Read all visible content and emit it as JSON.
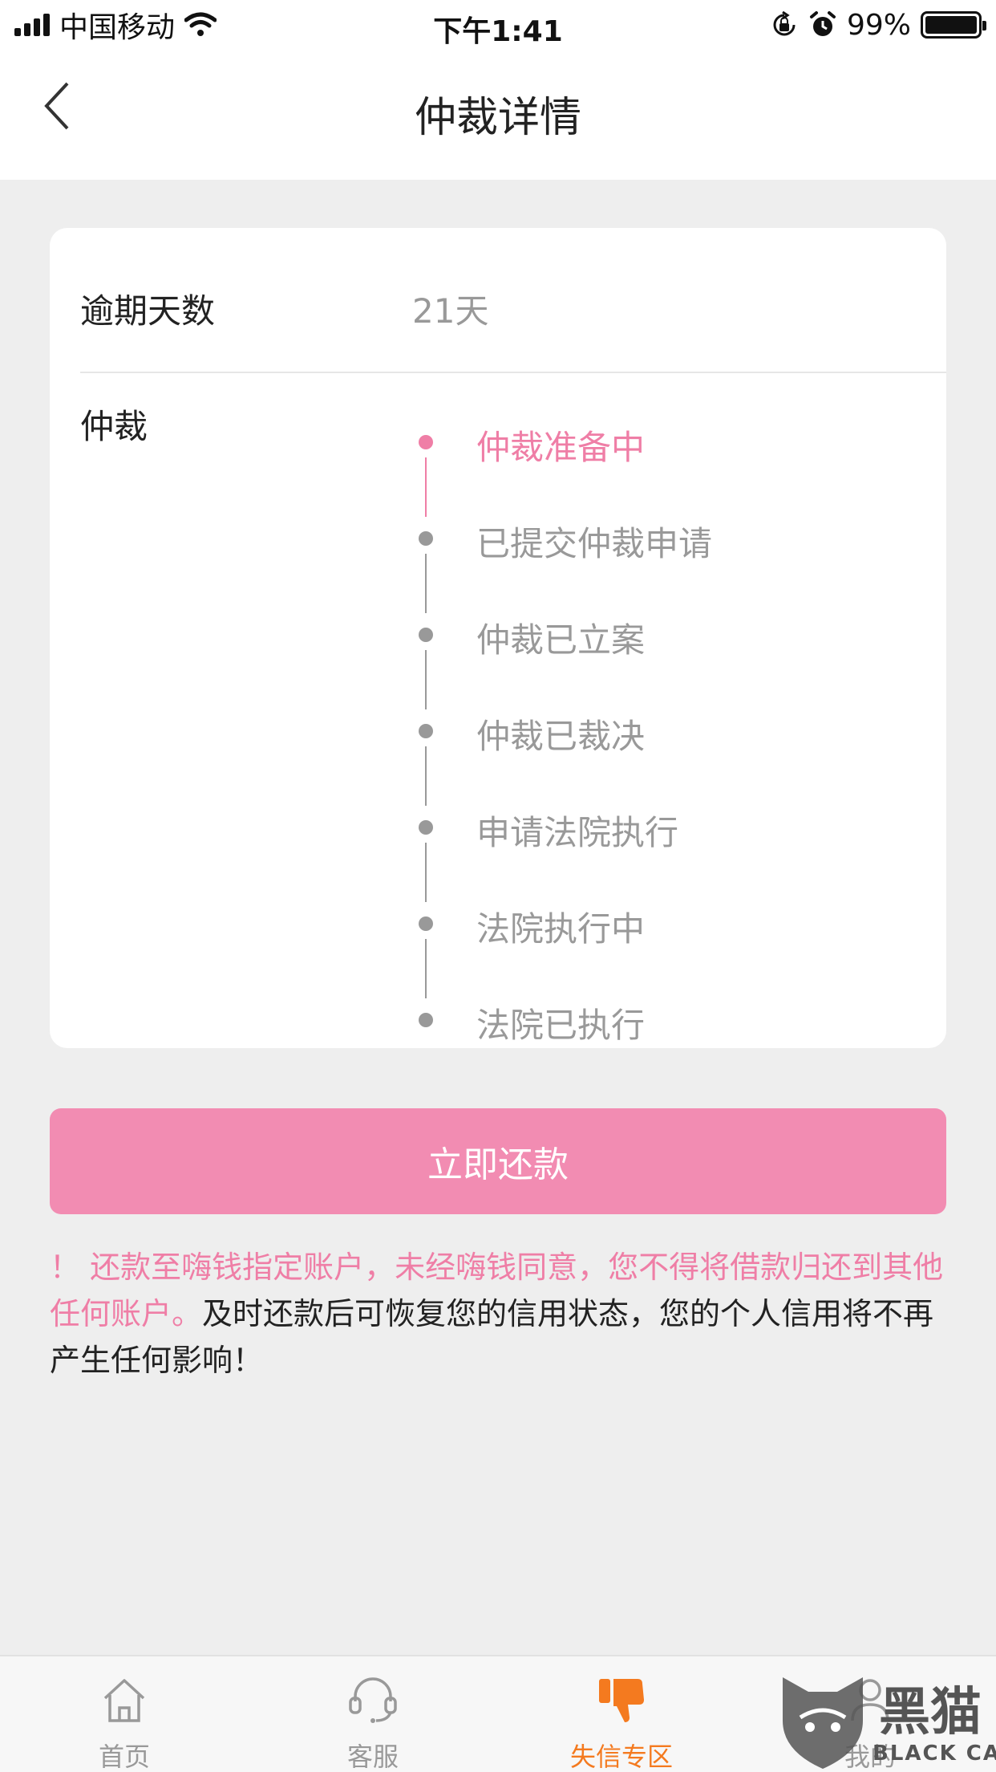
{
  "status_bar": {
    "carrier": "中国移动",
    "time": "下午1:41",
    "battery": "99%"
  },
  "nav": {
    "title": "仲裁详情"
  },
  "card": {
    "overdue_label": "逾期天数",
    "overdue_value": "21天",
    "arbitration_label": "仲裁",
    "timeline": [
      {
        "label": "仲裁准备中",
        "active": true
      },
      {
        "label": "已提交仲裁申请",
        "active": false
      },
      {
        "label": "仲裁已立案",
        "active": false
      },
      {
        "label": "仲裁已裁决",
        "active": false
      },
      {
        "label": "申请法院执行",
        "active": false
      },
      {
        "label": "法院执行中",
        "active": false
      },
      {
        "label": "法院已执行",
        "active": false
      }
    ]
  },
  "repay_button": {
    "label": "立即还款"
  },
  "notice": {
    "warning": "！ 还款至嗨钱指定账户，未经嗨钱同意，您不得将借款归还到其他任何账户。",
    "info": "及时还款后可恢复您的信用状态，您的个人信用将不再产生任何影响！"
  },
  "tabs": [
    {
      "label": "首页",
      "icon": "home-icon",
      "active": false
    },
    {
      "label": "客服",
      "icon": "headset-icon",
      "active": false
    },
    {
      "label": "失信专区",
      "icon": "thumbs-down-icon",
      "active": true
    },
    {
      "label": "我的",
      "icon": "user-icon",
      "active": false
    }
  ],
  "watermark": {
    "text": "黑猫",
    "sub": "BLACK CAT"
  },
  "colors": {
    "accent_pink": "#ef7ea6",
    "button_pink": "#f28cb2",
    "tab_active": "#f47a1f",
    "inactive_gray": "#999999"
  }
}
